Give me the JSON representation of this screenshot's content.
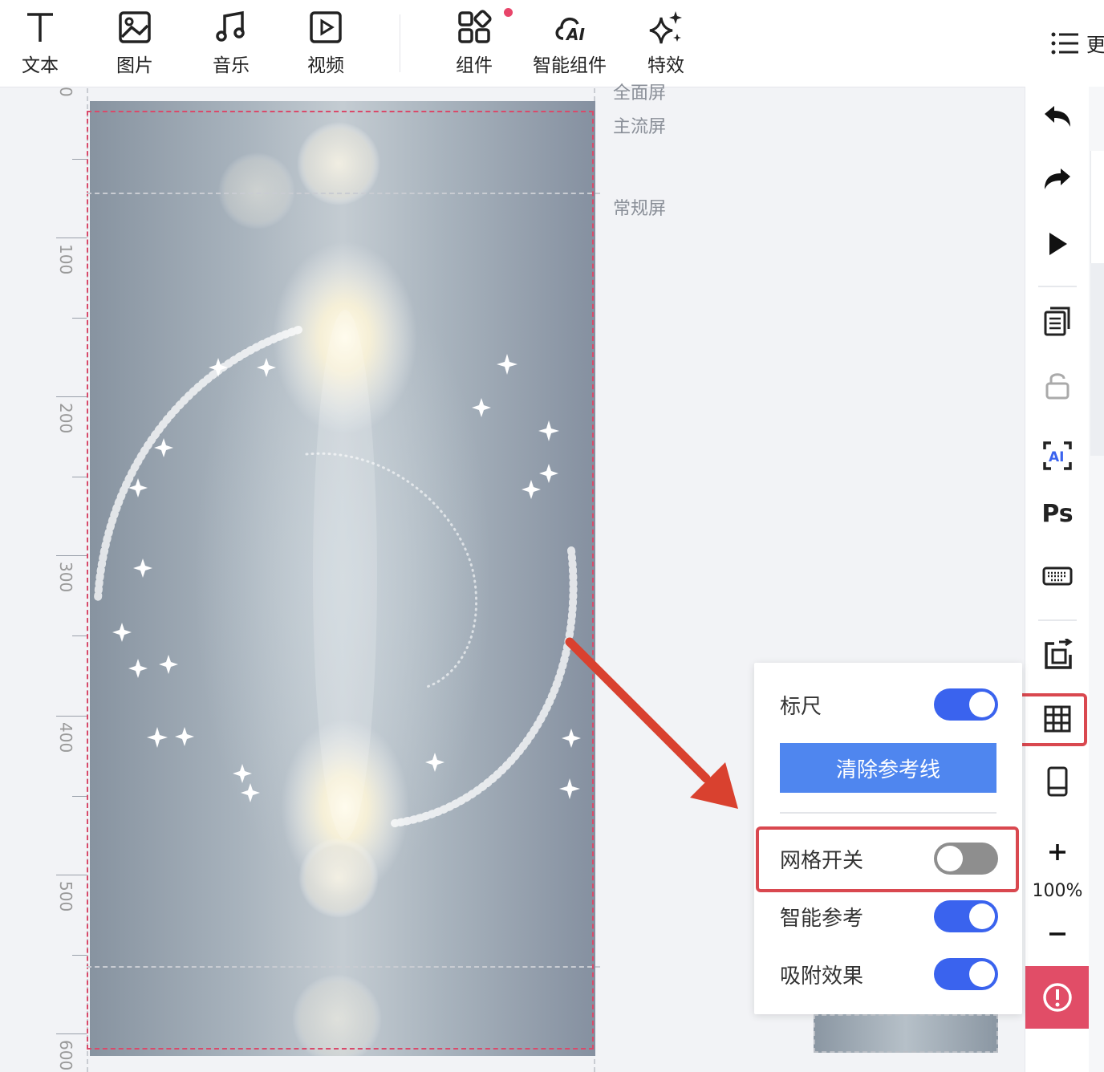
{
  "toolbar": {
    "tools": [
      {
        "label": "文本",
        "icon": "text-icon"
      },
      {
        "label": "图片",
        "icon": "image-icon"
      },
      {
        "label": "音乐",
        "icon": "music-icon"
      },
      {
        "label": "视频",
        "icon": "video-icon"
      },
      {
        "label": "组件",
        "icon": "components-icon"
      },
      {
        "label": "智能组件",
        "icon": "ai-cloud-icon"
      },
      {
        "label": "特效",
        "icon": "sparkle-icon"
      }
    ],
    "more_label": "更"
  },
  "ruler": {
    "labels": [
      "0",
      "100",
      "200",
      "300",
      "400",
      "500",
      "600"
    ]
  },
  "screen_labels": {
    "full": "全面屏",
    "mainstream": "主流屏",
    "regular": "常规屏"
  },
  "rail": {
    "icons": [
      "undo-icon",
      "redo-icon",
      "play-icon",
      "pages-icon",
      "lock-icon",
      "ai-scan-icon",
      "ps-icon",
      "keyboard-icon",
      "replace-icon",
      "grid-icon",
      "device-icon",
      "zoom-in-icon",
      "zoom-out-icon",
      "warning-icon"
    ],
    "ps_label": "Ps",
    "ai_label": "AI",
    "zoom": "100%"
  },
  "popover": {
    "ruler_label": "标尺",
    "ruler_on": true,
    "clear_button": "清除参考线",
    "grid_label": "网格开关",
    "grid_on": false,
    "smart_ref_label": "智能参考",
    "smart_ref_on": true,
    "snap_label": "吸附效果",
    "snap_on": true
  },
  "colors": {
    "accent_blue": "#3a63ee",
    "button_blue": "#4f86ef",
    "highlight_red": "#d9484f",
    "warning_red": "#e14d67"
  }
}
